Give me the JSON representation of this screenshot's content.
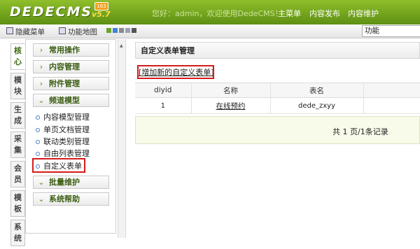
{
  "header": {
    "logo": "DEDECMS",
    "version": "v5.7",
    "badge": "163",
    "welcome": "您好：admin，欢迎使用DedeCMS！",
    "nav": [
      "主菜单",
      "内容发布",
      "内容维护"
    ]
  },
  "toolbar": {
    "hide_menu": "隐藏菜单",
    "func_map": "功能地图",
    "func_box": "功能"
  },
  "vertical_tabs": [
    "核心",
    "模块",
    "生成",
    "采集",
    "会员",
    "模板",
    "系统"
  ],
  "menu": {
    "groups": [
      {
        "label": "常用操作",
        "arrow": "›"
      },
      {
        "label": "内容管理",
        "arrow": "›"
      },
      {
        "label": "附件管理",
        "arrow": "›"
      },
      {
        "label": "频道模型",
        "arrow": "⌄"
      }
    ],
    "channel_items": [
      "内容模型管理",
      "单页文档管理",
      "联动类别管理",
      "自由列表管理",
      "自定义表单"
    ],
    "bottom_groups": [
      {
        "label": "批量维护",
        "arrow": "⌄"
      },
      {
        "label": "系统帮助",
        "arrow": "⌄"
      }
    ]
  },
  "main": {
    "title": "自定义表单管理",
    "add_link": "[增加新的自定义表单]",
    "columns": [
      "diyid",
      "名称",
      "表名"
    ],
    "rows": [
      {
        "diyid": "1",
        "name": "在线预约",
        "table": "dede_zxyy"
      }
    ],
    "pager": "共 1 页/1条记录"
  },
  "colors": {
    "header_green": "#6f9f1b",
    "highlight_red": "#d31c1c"
  }
}
